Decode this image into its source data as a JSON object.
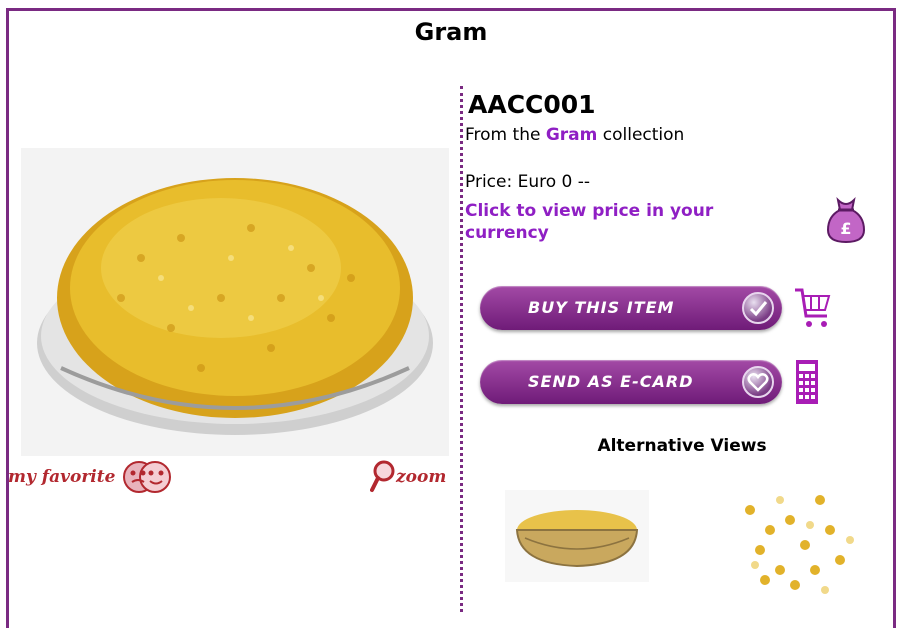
{
  "page": {
    "title": "Gram"
  },
  "product": {
    "code": "AACC001",
    "from_prefix": "From the ",
    "collection_name": "Gram",
    "from_suffix": " collection",
    "price_text": "Price: Euro 0 --",
    "currency_link": "Click to view price in your currency"
  },
  "buttons": {
    "buy_label": "BUY THIS ITEM",
    "ecard_label": "SEND AS E-CARD"
  },
  "links": {
    "favorite_label": "my favorite",
    "zoom_label": "zoom"
  },
  "alt_views": {
    "heading": "Alternative Views"
  },
  "colors": {
    "frame": "#7a2a82",
    "link": "#8f1fc4",
    "button": "#7a2a82",
    "script_text": "#b2282f"
  },
  "icons": [
    "money-bag-icon",
    "cart-icon",
    "calculator-icon",
    "theater-masks-icon",
    "magnifier-icon",
    "check-icon",
    "heart-icon"
  ]
}
